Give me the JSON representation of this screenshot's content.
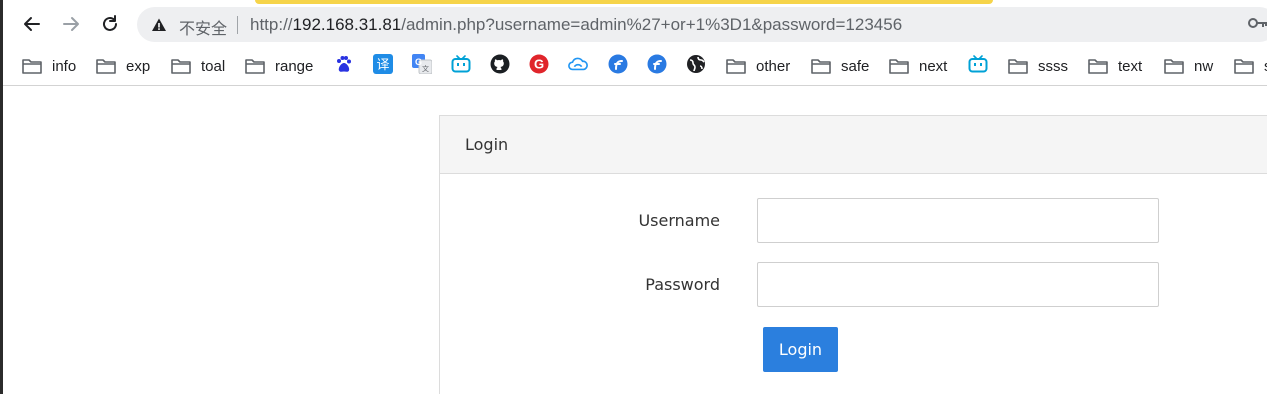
{
  "browser": {
    "address_bar": {
      "security_status": "不安全",
      "url_scheme": "http://",
      "url_host": "192.168.31.81",
      "url_rest": "/admin.php?username=admin%27+or+1%3D1&password=123456"
    },
    "bookmarks": [
      {
        "type": "folder",
        "label": "info"
      },
      {
        "type": "folder",
        "label": "exp"
      },
      {
        "type": "folder",
        "label": "toal"
      },
      {
        "type": "folder",
        "label": "range"
      },
      {
        "type": "icon",
        "name": "baidu-icon"
      },
      {
        "type": "icon",
        "name": "translate-icon",
        "glyph": "译"
      },
      {
        "type": "icon",
        "name": "google-translate-icon"
      },
      {
        "type": "icon",
        "name": "bilibili-icon"
      },
      {
        "type": "icon",
        "name": "github-icon"
      },
      {
        "type": "icon",
        "name": "red-g-icon",
        "glyph": "G"
      },
      {
        "type": "icon",
        "name": "cloud-icon"
      },
      {
        "type": "icon",
        "name": "blue-f-icon-1"
      },
      {
        "type": "icon",
        "name": "blue-f-icon-2"
      },
      {
        "type": "icon",
        "name": "globe-icon"
      },
      {
        "type": "folder",
        "label": "other"
      },
      {
        "type": "folder",
        "label": "safe"
      },
      {
        "type": "folder",
        "label": "next"
      },
      {
        "type": "icon",
        "name": "bilibili-icon-2"
      },
      {
        "type": "folder",
        "label": "ssss"
      },
      {
        "type": "folder",
        "label": "text"
      },
      {
        "type": "folder",
        "label": "nw"
      },
      {
        "type": "folder",
        "label": "s"
      }
    ]
  },
  "page": {
    "panel_title": "Login",
    "form": {
      "username_label": "Username",
      "username_value": "",
      "password_label": "Password",
      "password_value": "",
      "submit_label": "Login"
    }
  },
  "colors": {
    "accent": "#2b7fde",
    "top_highlight": "#f6d44a"
  }
}
